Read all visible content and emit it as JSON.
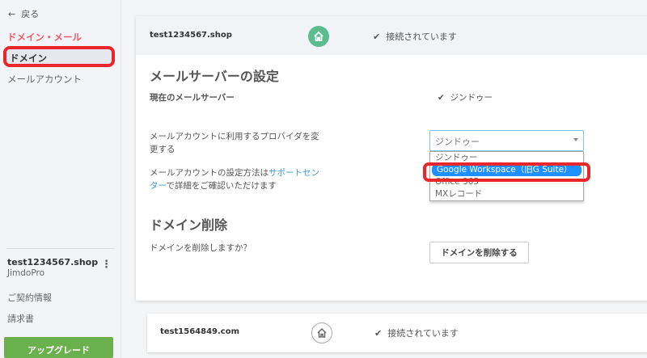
{
  "sidebar": {
    "back_label": "戻る",
    "section_title": "ドメイン・メール",
    "items": [
      {
        "label": "ドメイン"
      },
      {
        "label": "メールアカウント"
      }
    ],
    "site": {
      "name": "test1234567.shop",
      "plan": "JimdoPro"
    },
    "contract_label": "ご契約情報",
    "invoice_label": "請求書",
    "upgrade_label": "アップグレード"
  },
  "domains": [
    {
      "name": "test1234567.shop",
      "status": "接続されています",
      "primary": true
    },
    {
      "name": "test1564849.com",
      "status": "接続されています",
      "primary": false
    }
  ],
  "mail_settings": {
    "title": "メールサーバーの設定",
    "current_label": "現在のメールサーバー",
    "current_value": "ジンドゥー",
    "provider_label": "メールアカウントに利用するプロバイダを変更する",
    "provider_label_line1": "メールアカウントに利用するプロバイダを変",
    "provider_label_line2": "更する",
    "select_value": "ジンドゥー",
    "options": [
      "ジンドゥー",
      "Google Workspace（旧G Suite）",
      "Office 365",
      "MXレコード"
    ],
    "highlighted_option": "Google Workspace（旧G Suite）",
    "help_prefix": "メールアカウントの設定方法は",
    "help_link": "サポートセンター",
    "help_link_part1": "サポートセン",
    "help_link_part2": "ター",
    "help_suffix": "で詳細をご確認いただけます"
  },
  "delete_section": {
    "title": "ドメイン削除",
    "question": "ドメインを削除しますか？",
    "button_label": "ドメインを削除する"
  },
  "colors": {
    "accent_red": "#e8262b",
    "section_pink": "#ee5a6a",
    "upgrade_green": "#6ab04c",
    "home_green": "#5bbd8f",
    "option_blue": "#1e90ff",
    "link_blue": "#3a9ad9"
  }
}
